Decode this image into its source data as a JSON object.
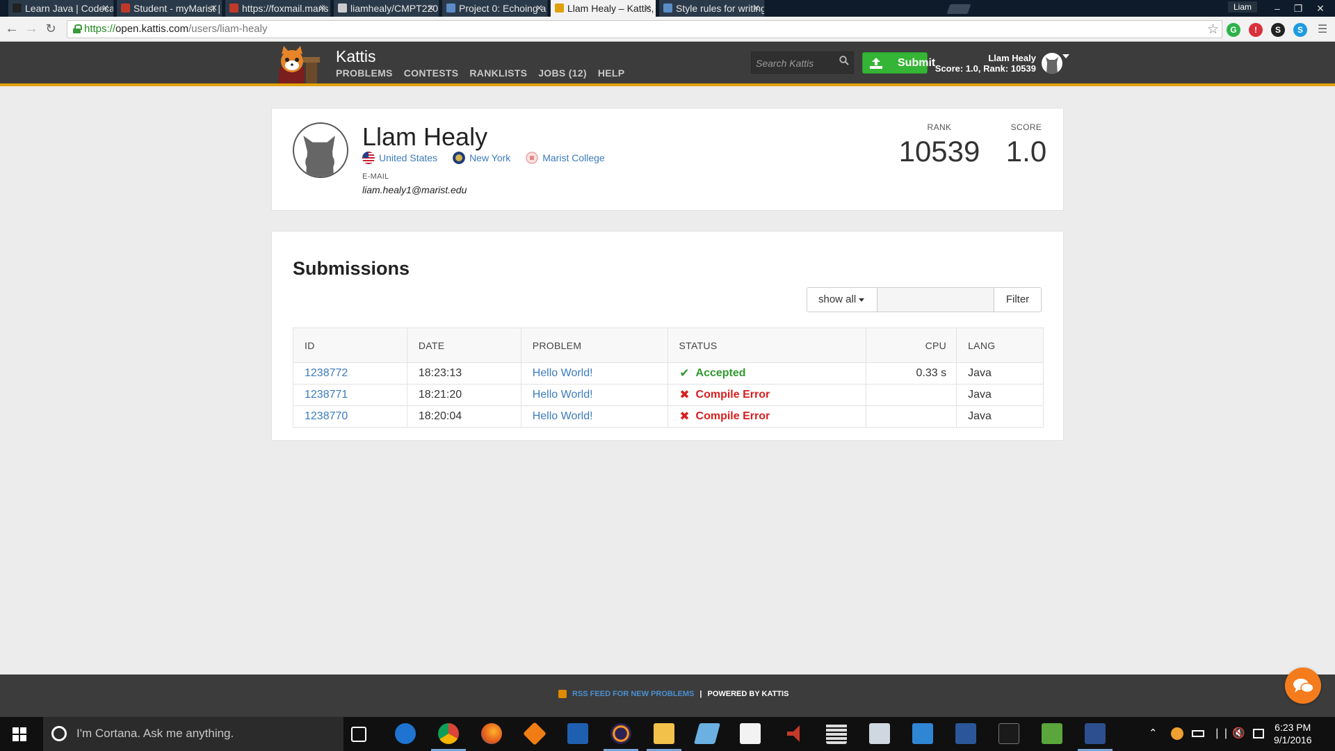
{
  "browser": {
    "tabs": [
      {
        "title": "Learn Java | Codecad",
        "favicon_color": "#222222",
        "active": false
      },
      {
        "title": "Student - myMarist |",
        "favicon_color": "#c0392b",
        "active": false
      },
      {
        "title": "https://foxmail.maris",
        "favicon_color": "#c0392b",
        "active": false
      },
      {
        "title": "liamhealy/CMPT220L",
        "favicon_color": "#cccccc",
        "active": false
      },
      {
        "title": "Project 0: Echoing a",
        "favicon_color": "#5b8cc8",
        "active": false
      },
      {
        "title": "Llam Healy – Kattis, K",
        "favicon_color": "#e0a10c",
        "active": true
      },
      {
        "title": "Style rules for writing",
        "favicon_color": "#5b8cc8",
        "active": false
      }
    ],
    "window_user": "Liam",
    "url": {
      "proto": "https://",
      "host": "open.kattis.com",
      "path": "/users/liam-healy"
    }
  },
  "kattis": {
    "brand": "Kattis",
    "nav": [
      "PROBLEMS",
      "CONTESTS",
      "RANKLISTS",
      "JOBS (12)",
      "HELP"
    ],
    "search_placeholder": "Search Kattis",
    "submit_label": "Submit",
    "user": {
      "name": "Llam Healy",
      "summary": "Score: 1.0, Rank: 10539"
    }
  },
  "profile": {
    "name": "Llam Healy",
    "country": "United States",
    "region": "New York",
    "school": "Marist College",
    "email_label": "E-MAIL",
    "email": "liam.healy1@marist.edu",
    "rank_label": "RANK",
    "rank": "10539",
    "score_label": "SCORE",
    "score": "1.0"
  },
  "submissions": {
    "title": "Submissions",
    "filter_select": "show all",
    "filter_button": "Filter",
    "columns": {
      "id": "ID",
      "date": "DATE",
      "problem": "PROBLEM",
      "status": "STATUS",
      "cpu": "CPU",
      "lang": "LANG"
    },
    "rows": [
      {
        "id": "1238772",
        "date": "18:23:13",
        "problem": "Hello World!",
        "status": "Accepted",
        "ok": true,
        "cpu": "0.33 s",
        "lang": "Java"
      },
      {
        "id": "1238771",
        "date": "18:21:20",
        "problem": "Hello World!",
        "status": "Compile Error",
        "ok": false,
        "cpu": "",
        "lang": "Java"
      },
      {
        "id": "1238770",
        "date": "18:20:04",
        "problem": "Hello World!",
        "status": "Compile Error",
        "ok": false,
        "cpu": "",
        "lang": "Java"
      }
    ]
  },
  "footer": {
    "rss_link": "RSS FEED FOR NEW PROBLEMS",
    "separator": "|",
    "powered": "POWERED BY KATTIS"
  },
  "taskbar": {
    "cortana_text": "I'm Cortana. Ask me anything.",
    "time": "6:23 PM",
    "date": "9/1/2016"
  },
  "colors": {
    "accent": "#e0a10c",
    "link": "#3c7bbd",
    "accepted": "#2f9a2f",
    "error": "#d81e1e",
    "submit": "#35b535"
  }
}
